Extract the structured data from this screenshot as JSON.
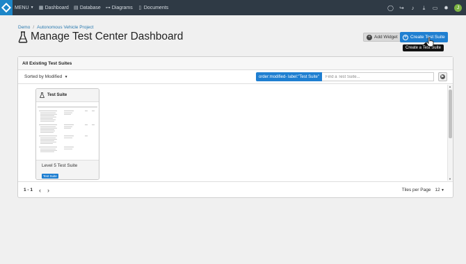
{
  "navbar": {
    "menu_label": "MENU",
    "items": [
      {
        "label": "Dashboard",
        "icon": "dashboard-icon"
      },
      {
        "label": "Database",
        "icon": "database-icon"
      },
      {
        "label": "Diagrams",
        "icon": "diagrams-icon"
      },
      {
        "label": "Documents",
        "icon": "documents-icon"
      }
    ],
    "right_icons": [
      "chat-icon",
      "share-icon",
      "bell-icon",
      "download-icon",
      "folder-icon",
      "gear-icon"
    ],
    "avatar_initial": "J"
  },
  "breadcrumb": {
    "root": "Demo",
    "separator": "/",
    "project": "Autonomous Vehicle Project"
  },
  "page": {
    "title": "Manage Test Center Dashboard"
  },
  "buttons": {
    "add_widget": "Add Widget",
    "create_suite": "Create Test Suite"
  },
  "tooltip": "Create a Test Suite",
  "panel": {
    "title": "All Existing Test Suites",
    "sort_label": "Sorted by Modified",
    "query_chip": "order:modified- label:\"Test Suite\"",
    "search_placeholder": "Find a Test Suite..."
  },
  "cards": [
    {
      "header": "Test Suite",
      "name": "Level 5 Test Suite",
      "badge": "Test Suite"
    }
  ],
  "footer": {
    "page_info": "1 - 1",
    "tiles_label": "Tiles per Page",
    "tiles_value": "12"
  },
  "colors": {
    "navbar": "#2f3a45",
    "accent": "#1f7fd1",
    "logo": "#1d86c8"
  }
}
